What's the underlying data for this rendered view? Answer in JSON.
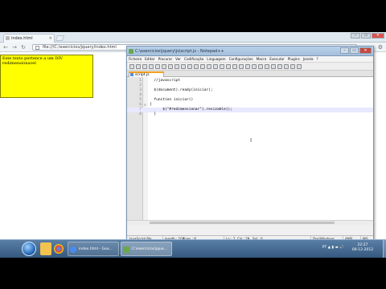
{
  "browser": {
    "tab_title": "index.html",
    "url": "file:///C:/exercicios/jquery/index.html",
    "window_controls": [
      "–",
      "▭",
      "✕"
    ]
  },
  "page": {
    "div_text": "Este texto pertence a um DIV redimensionavel"
  },
  "npp": {
    "title": "C:\\exercicios\\jquery\\js\\script.js - Notepad++",
    "menus": [
      "Ficheiro",
      "Editar",
      "Procurar",
      "Ver",
      "Codificação",
      "Linguagem",
      "Configurações",
      "Macro",
      "Executar",
      "Plugins",
      "Janela",
      "?"
    ],
    "tab_label": "script.js",
    "lines": [
      {
        "num": "1",
        "fold": "",
        "code": "  //javascript"
      },
      {
        "num": "2",
        "fold": "",
        "code": ""
      },
      {
        "num": "3",
        "fold": "",
        "code": "  $(document).ready(iniciar);"
      },
      {
        "num": "4",
        "fold": "",
        "code": ""
      },
      {
        "num": "5",
        "fold": "",
        "code": "  function iniciar()"
      },
      {
        "num": "6",
        "fold": "⊟",
        "code": "{"
      },
      {
        "num": "7",
        "fold": "",
        "code": "      $(\"#redimensionar\").resizable();"
      },
      {
        "num": "8",
        "fold": "",
        "code": "  }"
      }
    ],
    "status": {
      "lang": "JavaScript file",
      "length": "length : 109",
      "lines": "lines : 8",
      "pos": "Ln : 7",
      "col": "Col : 29",
      "sel": "Sel : 0",
      "eol": "Dos\\Windows",
      "enc": "ANSI",
      "ins": "INS"
    }
  },
  "taskbar": {
    "tasks": [
      {
        "label": "index.html - Goo..."
      },
      {
        "label": "C:\\exercicios\\jque..."
      }
    ],
    "tray_lang": "PT",
    "time": "22:27",
    "date": "09-12-2012"
  },
  "colors": {
    "div_bg": "#ffff00",
    "tab_accent": "#f4a020",
    "taskbar": "#35597f"
  }
}
